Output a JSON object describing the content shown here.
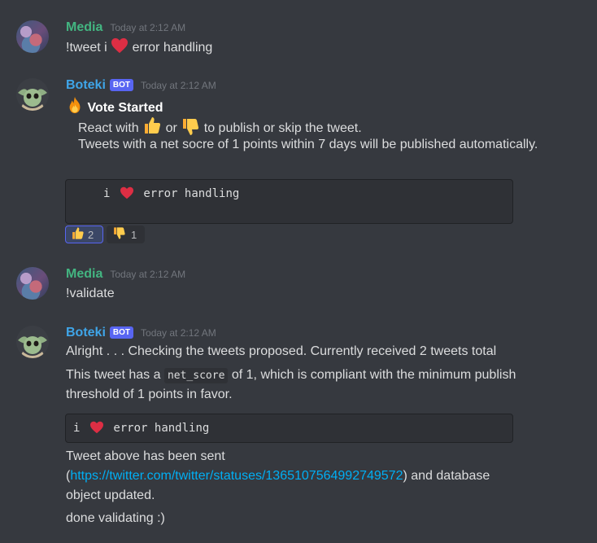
{
  "messages": [
    {
      "author": "Media",
      "timestamp": "Today at 2:12 AM",
      "text_before": "!tweet i",
      "heart_icon": "red-heart",
      "text_after": "error handling"
    },
    {
      "author": "Boteki",
      "bot_tag": "BOT",
      "timestamp": "Today at 2:12 AM",
      "fire_icon": "fire",
      "vote_title": "Vote Started",
      "line1_prefix": "React with",
      "line1_or": "or",
      "line1_suffix": "to publish or skip the tweet.",
      "line2": "Tweets with a net socre of 1 points within 7 days will be published automatically.",
      "code_i": "i",
      "code_text": "error handling",
      "reactions": [
        {
          "icon": "thumbs-up",
          "count": "2"
        },
        {
          "icon": "thumbs-down",
          "count": "1"
        }
      ]
    },
    {
      "author": "Media",
      "timestamp": "Today at 2:12 AM",
      "text": "!validate"
    },
    {
      "author": "Boteki",
      "bot_tag": "BOT",
      "timestamp": "Today at 2:12 AM",
      "line1": "Alright . . . Checking the tweets proposed. Currently received 2 tweets total",
      "line2_prefix": "This tweet has a",
      "line2_code": "net_score",
      "line2_suffix": "of 1, which is compliant with the minimum publish",
      "line3": "threshold of 1 points in favor.",
      "code_i": "i",
      "code_text": "error handling",
      "sent_line1": "Tweet above has been sent",
      "sent_open": "(",
      "sent_link": "https://twitter.com/twitter/statuses/1365107564992749572",
      "sent_close": ") and database",
      "sent_line3": "object updated.",
      "done": "done validating :)"
    }
  ],
  "colors": {
    "background": "#36393f",
    "media_name": "#43b581",
    "bot_name": "#3fa5e8",
    "bot_tag": "#5865f2",
    "link": "#00aff4"
  }
}
